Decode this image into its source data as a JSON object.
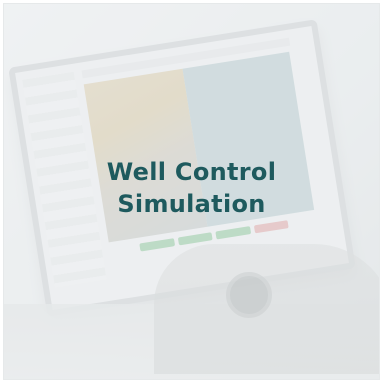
{
  "title": {
    "line1": "Well Control",
    "line2": "Simulation"
  },
  "colors": {
    "title": "#1e5a5e",
    "panel": "#8fb1b3",
    "button_green": "#7fbf8e",
    "button_red": "#d99a9a"
  }
}
